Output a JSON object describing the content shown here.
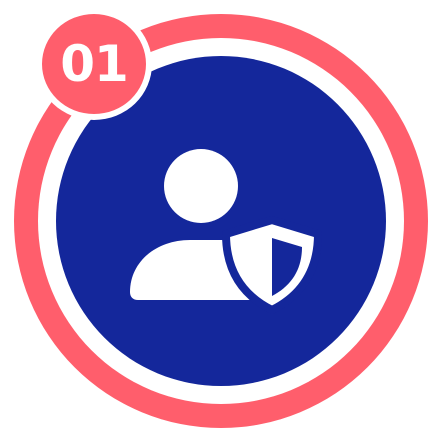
{
  "badge": {
    "number": "01"
  },
  "icon": {
    "name": "user-shield-icon"
  },
  "colors": {
    "ring": "#FF5E6C",
    "core": "#14279B",
    "gap": "#FFFFFF",
    "glyph": "#FFFFFF",
    "badge_text": "#FFFFFF"
  }
}
